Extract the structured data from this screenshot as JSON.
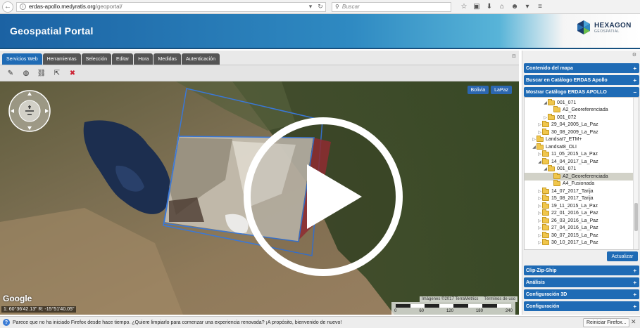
{
  "browser": {
    "url_domain": "erdas-apollo.medyratis.org",
    "url_path": "/geoportal/",
    "search_placeholder": "Buscar"
  },
  "header": {
    "title": "Geospatial Portal",
    "logo_name": "HEXAGON",
    "logo_sub": "GEOSPATIAL"
  },
  "tabs": [
    {
      "label": "Servicios Web",
      "active": true
    },
    {
      "label": "Herramientas"
    },
    {
      "label": "Selección"
    },
    {
      "label": "Editar"
    },
    {
      "label": "Hora"
    },
    {
      "label": "Medidas"
    },
    {
      "label": "Autenticación"
    }
  ],
  "map": {
    "region_buttons": [
      "Bolivia",
      "LaPaz"
    ],
    "google_label": "Google",
    "coords": "1: 60°36'42.13\"  R: -15°51'40.05\"",
    "attribution": "Imágenes ©2017 TerraMetrics",
    "terms": "Términos de uso",
    "scale_labels": [
      "0",
      "60",
      "120",
      "180",
      "240"
    ]
  },
  "panel": {
    "sections_top": [
      "Contenido del mapa",
      "Buscar en Catálogo ERDAS Apollo",
      "Mostrar Catálogo ERDAS APOLLO"
    ],
    "tree": [
      {
        "indent": 3,
        "toggle": "◢",
        "label": "001_071"
      },
      {
        "indent": 4,
        "toggle": "",
        "label": "A2_Georeferenciada"
      },
      {
        "indent": 3,
        "toggle": "▷",
        "label": "001_072"
      },
      {
        "indent": 2,
        "toggle": "▷",
        "label": "29_04_2005_La_Paz"
      },
      {
        "indent": 2,
        "toggle": "▷",
        "label": "30_08_2009_La_Paz"
      },
      {
        "indent": 1,
        "toggle": "▷",
        "label": "Landsat7_ETM+"
      },
      {
        "indent": 1,
        "toggle": "◢",
        "label": "Landsat8_OLI"
      },
      {
        "indent": 2,
        "toggle": "▷",
        "label": "11_05_2015_La_Paz"
      },
      {
        "indent": 2,
        "toggle": "◢",
        "label": "14_04_2017_La_Paz"
      },
      {
        "indent": 3,
        "toggle": "◢",
        "label": "001_071"
      },
      {
        "indent": 4,
        "toggle": "",
        "label": "A2_Georeferenciada",
        "selected": true
      },
      {
        "indent": 4,
        "toggle": "",
        "label": "A4_Fusionada"
      },
      {
        "indent": 2,
        "toggle": "▷",
        "label": "14_07_2017_Tarija"
      },
      {
        "indent": 2,
        "toggle": "▷",
        "label": "15_08_2017_Tarija"
      },
      {
        "indent": 2,
        "toggle": "▷",
        "label": "19_11_2015_La_Paz"
      },
      {
        "indent": 2,
        "toggle": "▷",
        "label": "22_01_2016_La_Paz"
      },
      {
        "indent": 2,
        "toggle": "▷",
        "label": "26_03_2016_La_Paz"
      },
      {
        "indent": 2,
        "toggle": "▷",
        "label": "27_04_2016_La_Paz"
      },
      {
        "indent": 2,
        "toggle": "▷",
        "label": "30_07_2015_La_Paz"
      },
      {
        "indent": 2,
        "toggle": "▷",
        "label": "30_10_2017_La_Paz"
      }
    ],
    "update_button": "Actualizar",
    "sections_bottom": [
      "Clip-Zip-Ship",
      "Análisis",
      "Configuración 3D",
      "Configuración"
    ]
  },
  "notification": {
    "text": "Parece que no ha iniciado Firefox desde hace tiempo. ¿Quiere limpiarlo para comenzar una experiencia renovada? ¡A propósito, bienvenido de nuevo!",
    "button": "Reiniciar Firefox..."
  },
  "colors": {
    "accent": "#1f6bb5",
    "header_dark": "#1b62a3"
  }
}
